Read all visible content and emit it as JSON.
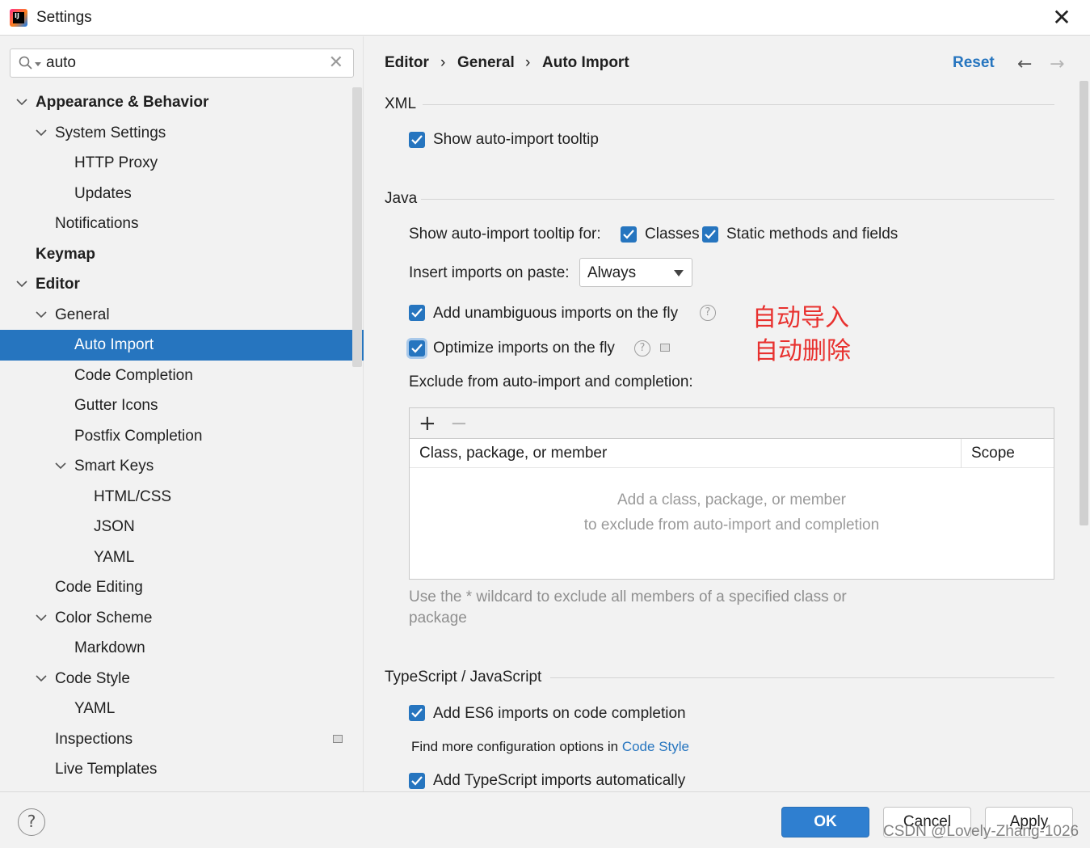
{
  "window": {
    "title": "Settings",
    "close_glyph": "✕"
  },
  "search": {
    "value": "auto",
    "clear_glyph": "✕"
  },
  "tree": [
    {
      "label": "Appearance & Behavior",
      "level": 0,
      "bold": true,
      "expanded": true
    },
    {
      "label": "System Settings",
      "level": 1,
      "expanded": true
    },
    {
      "label": "HTTP Proxy",
      "level": 2
    },
    {
      "label": "Updates",
      "level": 2
    },
    {
      "label": "Notifications",
      "level": 1
    },
    {
      "label": "Keymap",
      "level": 0,
      "bold": true
    },
    {
      "label": "Editor",
      "level": 0,
      "bold": true,
      "expanded": true
    },
    {
      "label": "General",
      "level": 1,
      "expanded": true
    },
    {
      "label": "Auto Import",
      "level": 2,
      "selected": true
    },
    {
      "label": "Code Completion",
      "level": 2
    },
    {
      "label": "Gutter Icons",
      "level": 2
    },
    {
      "label": "Postfix Completion",
      "level": 2
    },
    {
      "label": "Smart Keys",
      "level": 2,
      "expanded": true
    },
    {
      "label": "HTML/CSS",
      "level": 3
    },
    {
      "label": "JSON",
      "level": 3
    },
    {
      "label": "YAML",
      "level": 3
    },
    {
      "label": "Code Editing",
      "level": 1
    },
    {
      "label": "Color Scheme",
      "level": 1,
      "expanded": true
    },
    {
      "label": "Markdown",
      "level": 2
    },
    {
      "label": "Code Style",
      "level": 1,
      "expanded": true
    },
    {
      "label": "YAML",
      "level": 2
    },
    {
      "label": "Inspections",
      "level": 1,
      "gear": true
    },
    {
      "label": "Live Templates",
      "level": 1
    }
  ],
  "breadcrumb": [
    "Editor",
    "General",
    "Auto Import"
  ],
  "breadcrumb_sep": "›",
  "header": {
    "reset": "Reset",
    "back": "←",
    "forward": "→"
  },
  "xml": {
    "section": "XML",
    "show_tooltip": "Show auto-import tooltip"
  },
  "java": {
    "section": "Java",
    "tooltip_for": "Show auto-import tooltip for:",
    "classes": "Classes",
    "static_members": "Static methods and fields",
    "insert_on_paste_label": "Insert imports on paste:",
    "insert_on_paste_value": "Always",
    "add_unambiguous": "Add unambiguous imports on the fly",
    "optimize": "Optimize imports on the fly",
    "help_glyph": "?",
    "exclude_label": "Exclude from auto-import and completion:",
    "add_glyph": "+",
    "remove_glyph": "−",
    "col_class": "Class, package, or member",
    "col_scope": "Scope",
    "empty_line1": "Add a class, package, or member",
    "empty_line2": "to exclude from auto-import and completion",
    "hint": "Use the * wildcard to exclude all members of a specified class or package"
  },
  "annotations": {
    "auto_import": "自动导入",
    "auto_delete": "自动删除"
  },
  "ts": {
    "section": "TypeScript / JavaScript",
    "es6": "Add ES6 imports on code completion",
    "more_prefix": "Find more configuration options in",
    "more_link": "Code Style",
    "ts_auto": "Add TypeScript imports automatically"
  },
  "footer": {
    "help": "?",
    "ok": "OK",
    "cancel": "Cancel",
    "apply": "Apply"
  },
  "watermark": "CSDN @Lovely-Zhang-1026",
  "colors": {
    "accent": "#2675bf",
    "annotation": "#e8312f"
  }
}
